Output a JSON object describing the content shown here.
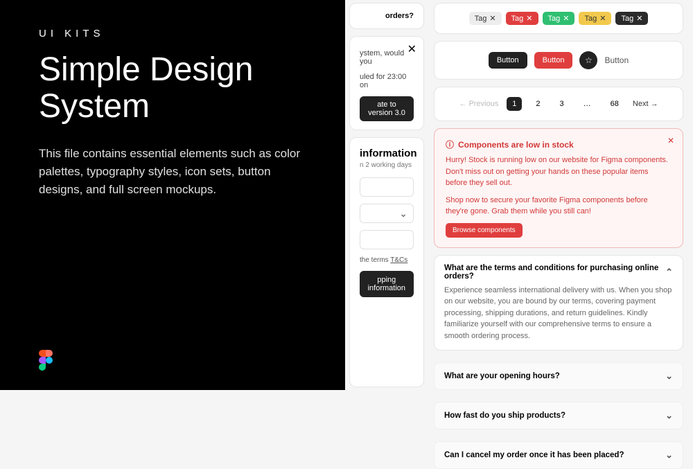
{
  "left": {
    "kicker": "UI KITS",
    "title_line1": "Simple Design",
    "title_line2": "System",
    "description": "This file contains essential elements such as color palettes, typography styles, icon sets, button designs, and full screen mockups."
  },
  "modal": {
    "close": "✕",
    "line1": "ystem, would you",
    "line2": "uled for 23:00 on",
    "button": "ate to version 3.0"
  },
  "form": {
    "title": "information",
    "subtitle": "n 2 working days",
    "terms_prefix": "the terms ",
    "terms_link": "T&Cs",
    "submit": "pping information"
  },
  "tags": [
    "Tag",
    "Tag",
    "Tag",
    "Tag",
    "Tag"
  ],
  "buttons": {
    "dark": "Button",
    "red": "Button",
    "star": "☆",
    "text": "Button"
  },
  "pagination": {
    "prev": "Previous",
    "pages": [
      "1",
      "2",
      "3",
      "…",
      "68"
    ],
    "next": "Next"
  },
  "alert": {
    "title": "Components are low in stock",
    "body1": "Hurry! Stock is running low on our website for Figma components. Don't miss out on getting your hands on these popular items before they sell out.",
    "body2": "Shop now to secure your favorite Figma components before they're gone. Grab them while you still can!",
    "button": "Browse components"
  },
  "accordion": {
    "q1": "What are the terms and conditions for purchasing online orders?",
    "a1": "Experience seamless international delivery with us. When you shop on our website, you are bound by our terms, covering payment processing, shipping durations, and return guidelines. Kindly familiarize yourself with our comprehensive terms to ensure a smooth ordering process.",
    "q2": "What are your opening hours?",
    "q3": "How fast do you ship products?",
    "q4": "Can I cancel my order once it has been placed?"
  },
  "partial_heading": "orders?"
}
